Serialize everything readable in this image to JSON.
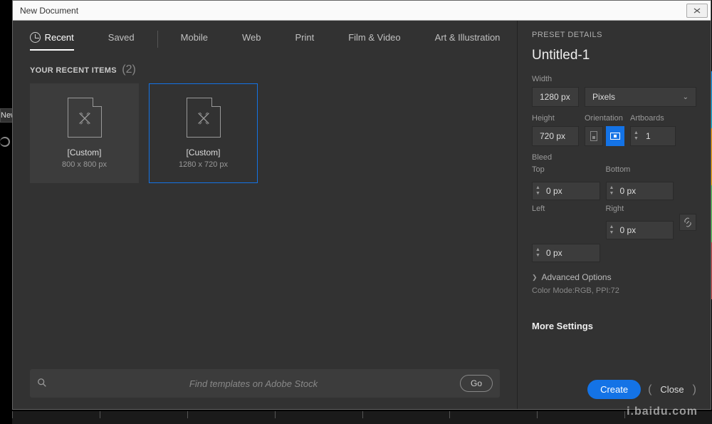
{
  "titlebar": {
    "title": "New Document"
  },
  "tabs": {
    "recent": "Recent",
    "saved": "Saved",
    "mobile": "Mobile",
    "web": "Web",
    "print": "Print",
    "film": "Film & Video",
    "art": "Art & Illustration"
  },
  "recent": {
    "title": "YOUR RECENT ITEMS",
    "count": "(2)",
    "items": [
      {
        "name": "[Custom]",
        "dim": "800 x 800 px"
      },
      {
        "name": "[Custom]",
        "dim": "1280 x 720 px"
      }
    ]
  },
  "search": {
    "placeholder": "Find templates on Adobe Stock",
    "go": "Go"
  },
  "side": {
    "header": "PRESET DETAILS",
    "docname": "Untitled-1",
    "labels": {
      "width": "Width",
      "height": "Height",
      "orientation": "Orientation",
      "artboards": "Artboards",
      "bleed": "Bleed",
      "top": "Top",
      "bottom": "Bottom",
      "left": "Left",
      "right": "Right"
    },
    "values": {
      "width": "1280 px",
      "height": "720 px",
      "unit": "Pixels",
      "artboards": "1",
      "top": "0 px",
      "bottom": "0 px",
      "left": "0 px",
      "right": "0 px"
    },
    "advanced": "Advanced Options",
    "colorMode": "Color Mode:RGB, PPI:72",
    "moreSettings": "More Settings"
  },
  "footer": {
    "create": "Create",
    "close": "Close"
  },
  "watermark": "i.baidu.com",
  "bgSliver": "New"
}
